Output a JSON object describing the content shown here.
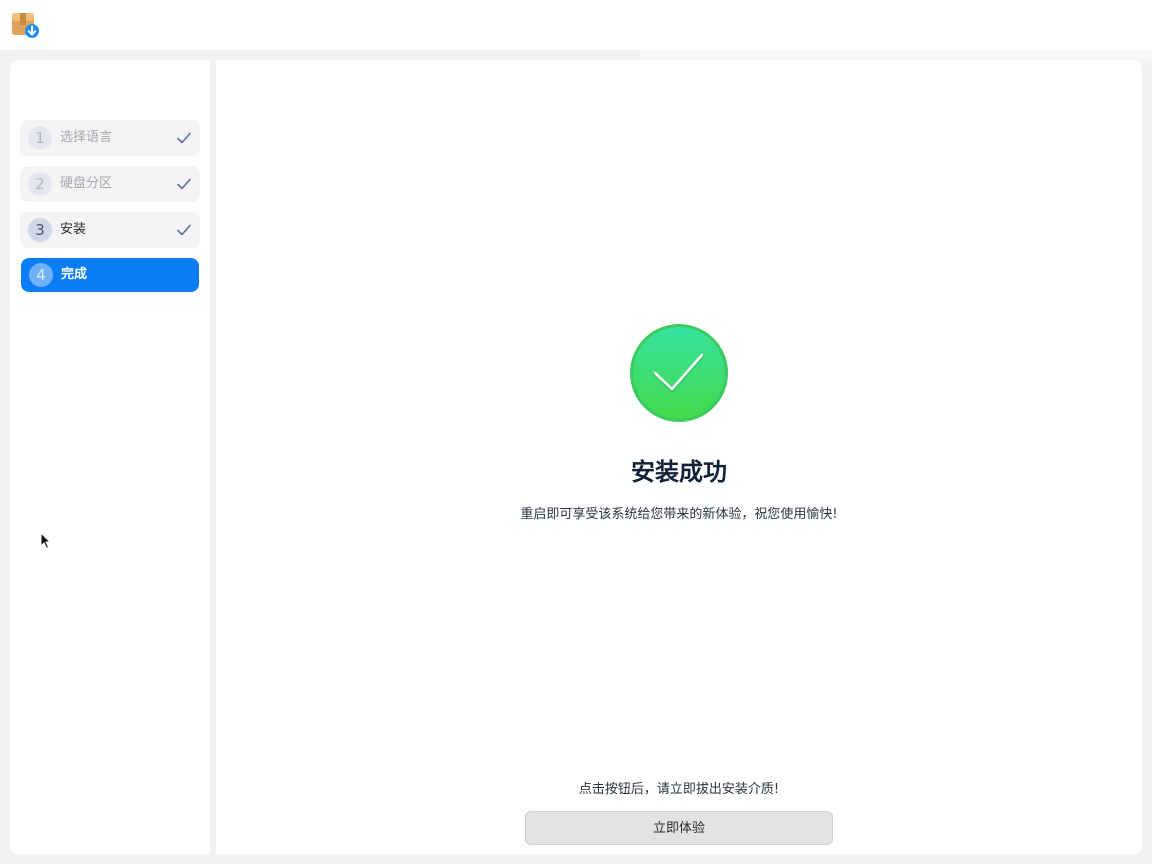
{
  "app": {
    "icon": "installer-package-icon"
  },
  "sidebar": {
    "steps": [
      {
        "number": "1",
        "label": "选择语言",
        "state": "done"
      },
      {
        "number": "2",
        "label": "硬盘分区",
        "state": "done"
      },
      {
        "number": "3",
        "label": "安装",
        "state": "done"
      },
      {
        "number": "4",
        "label": "完成",
        "state": "active"
      }
    ]
  },
  "main": {
    "icon": "success-check-icon",
    "title": "安装成功",
    "description": "重启即可享受该系统给您带来的新体验，祝您使用愉快!",
    "notice": "点击按钮后，请立即拔出安装介质!",
    "button_label": "立即体验"
  },
  "colors": {
    "accent": "#0a7cf5",
    "success": "#3ddc6e",
    "check": "#5a6fa8"
  }
}
